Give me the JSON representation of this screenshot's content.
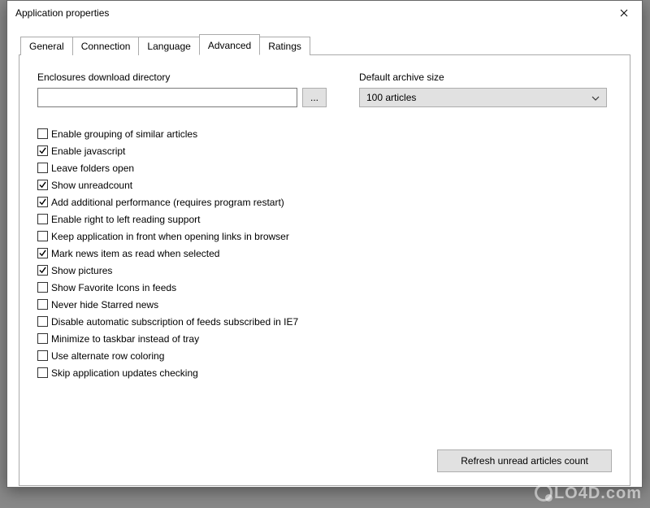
{
  "window": {
    "title": "Application properties"
  },
  "tabs": [
    {
      "label": "General",
      "active": false
    },
    {
      "label": "Connection",
      "active": false
    },
    {
      "label": "Language",
      "active": false
    },
    {
      "label": "Advanced",
      "active": true
    },
    {
      "label": "Ratings",
      "active": false
    }
  ],
  "advanced": {
    "enclosures_label": "Enclosures download directory",
    "enclosures_value": "",
    "browse_label": "...",
    "archive_label": "Default archive size",
    "archive_value": "100 articles",
    "options": [
      {
        "label": "Enable grouping of similar articles",
        "checked": false
      },
      {
        "label": "Enable javascript",
        "checked": true
      },
      {
        "label": "Leave folders open",
        "checked": false
      },
      {
        "label": "Show unreadcount",
        "checked": true
      },
      {
        "label": "Add additional performance (requires program restart)",
        "checked": true
      },
      {
        "label": "Enable right to left reading support",
        "checked": false
      },
      {
        "label": "Keep application in front when opening links in browser",
        "checked": false
      },
      {
        "label": "Mark news item as read when selected",
        "checked": true
      },
      {
        "label": "Show pictures",
        "checked": true
      },
      {
        "label": "Show Favorite Icons in feeds",
        "checked": false
      },
      {
        "label": "Never hide Starred news",
        "checked": false
      },
      {
        "label": "Disable automatic subscription of feeds subscribed in IE7",
        "checked": false
      },
      {
        "label": "Minimize to taskbar instead of tray",
        "checked": false
      },
      {
        "label": "Use alternate row coloring",
        "checked": false
      },
      {
        "label": "Skip application updates checking",
        "checked": false
      }
    ],
    "refresh_label": "Refresh unread articles count"
  },
  "watermark": "LO4D.com"
}
